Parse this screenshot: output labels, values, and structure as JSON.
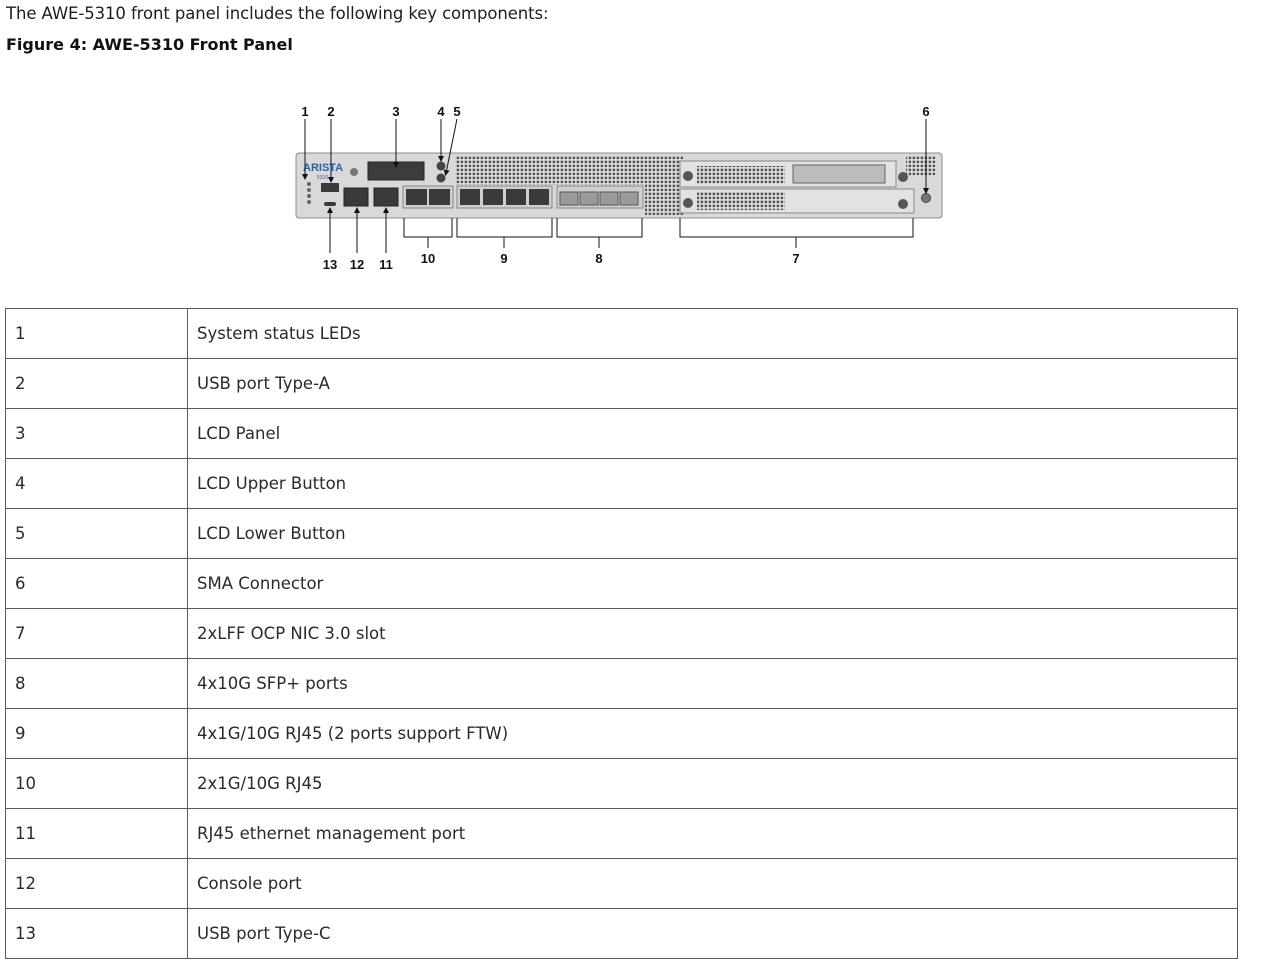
{
  "intro_text": "The AWE-5310 front panel includes the following key components:",
  "figure": {
    "caption": "Figure 4: AWE-5310 Front Panel",
    "brand_logo": "ARISTA",
    "model_label": "5310",
    "callouts_top": [
      "1",
      "2",
      "3",
      "4",
      "5",
      "6"
    ],
    "callouts_bottom": [
      "13",
      "12",
      "11",
      "10",
      "9",
      "8",
      "7"
    ],
    "colors": {
      "chassis": "#d9d9d9",
      "chassis_edge": "#8c8c8c",
      "vent": "#555555",
      "port": "#3a3a3a",
      "port_led": "#c9a227",
      "lcd": "#3c3c3c",
      "logo": "#2f5fa8"
    }
  },
  "components": [
    {
      "number": "1",
      "description": "System status LEDs"
    },
    {
      "number": "2",
      "description": "USB port Type-A"
    },
    {
      "number": "3",
      "description": "LCD Panel"
    },
    {
      "number": "4",
      "description": "LCD Upper Button"
    },
    {
      "number": "5",
      "description": "LCD Lower Button"
    },
    {
      "number": "6",
      "description": "SMA Connector"
    },
    {
      "number": "7",
      "description": "2xLFF OCP NIC 3.0 slot"
    },
    {
      "number": "8",
      "description": "4x10G SFP+ ports"
    },
    {
      "number": "9",
      "description": "4x1G/10G RJ45 (2 ports support FTW)"
    },
    {
      "number": "10",
      "description": "2x1G/10G RJ45"
    },
    {
      "number": "11",
      "description": "RJ45 ethernet management port"
    },
    {
      "number": "12",
      "description": "Console port"
    },
    {
      "number": "13",
      "description": "USB port Type-C"
    }
  ]
}
